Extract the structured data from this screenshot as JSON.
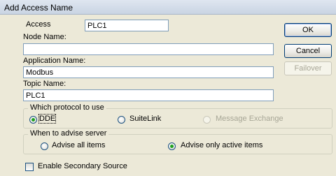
{
  "window": {
    "title": "Add Access Name"
  },
  "form": {
    "access_label": "Access",
    "access_value": "PLC1",
    "node_label": "Node Name:",
    "node_value": "",
    "application_label": "Application Name:",
    "application_value": "Modbus",
    "topic_label": "Topic Name:",
    "topic_value": "PLC1"
  },
  "buttons": {
    "ok": "OK",
    "cancel": "Cancel",
    "failover": "Failover"
  },
  "protocol": {
    "legend": "Which protocol to use",
    "options": [
      {
        "label": "DDE",
        "checked": true,
        "enabled": true
      },
      {
        "label": "SuiteLink",
        "checked": false,
        "enabled": true
      },
      {
        "label": "Message Exchange",
        "checked": false,
        "enabled": false
      }
    ]
  },
  "advise": {
    "legend": "When to advise server",
    "options": [
      {
        "label": "Advise all items",
        "checked": false
      },
      {
        "label": "Advise only active items",
        "checked": true
      }
    ]
  },
  "secondary": {
    "label": "Enable Secondary Source",
    "checked": false
  }
}
